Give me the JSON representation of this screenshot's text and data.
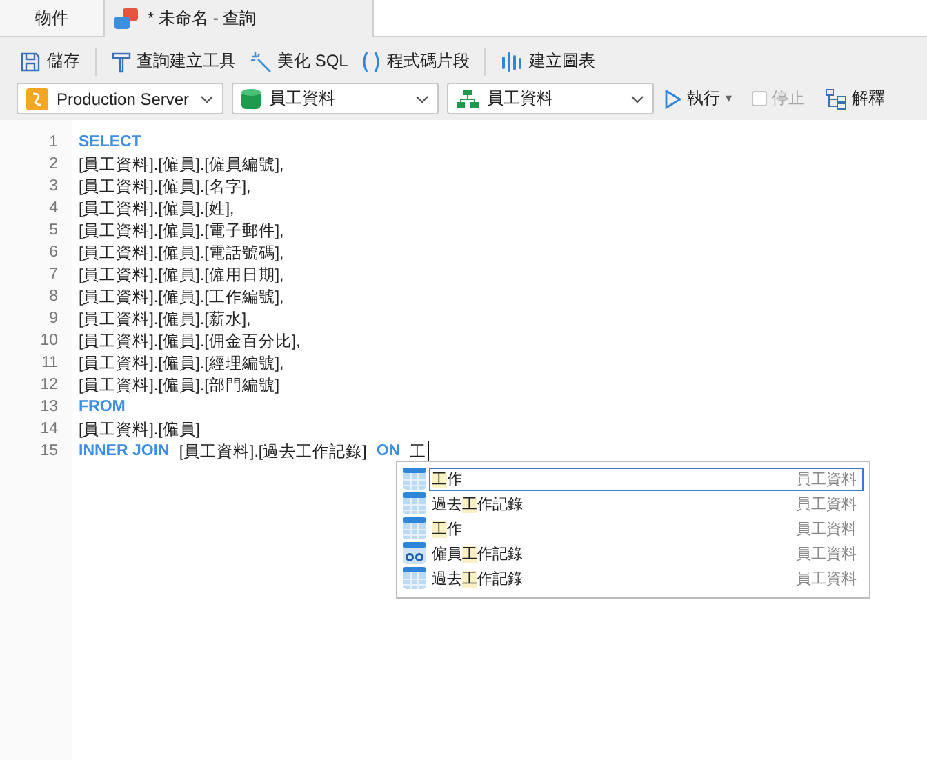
{
  "tabs": [
    {
      "label": "物件",
      "kind": "plain",
      "selected": false
    },
    {
      "label": "* 未命名 - 查詢",
      "kind": "query",
      "selected": true
    }
  ],
  "toolbar": [
    {
      "label": "儲存"
    },
    {
      "label": "查詢建立工具"
    },
    {
      "label": "美化 SQL"
    },
    {
      "label": "程式碼片段"
    },
    {
      "label": "建立圖表"
    }
  ],
  "selectors": [
    {
      "value": "Production Server"
    },
    {
      "value": "員工資料"
    },
    {
      "value": "員工資料"
    }
  ],
  "run": {
    "label": "執行",
    "caret": "▾"
  },
  "stop": {
    "label": "停止",
    "checked": false,
    "disabled": true
  },
  "explain": {
    "label": "解釋"
  },
  "code_lines": [
    {
      "number": "1",
      "tokens": [
        {
          "kind": "keyword",
          "text": "SELECT"
        }
      ]
    },
    {
      "number": "2",
      "tokens": [
        {
          "kind": "text",
          "text": "[員工資料].[僱員].[僱員編號],"
        }
      ]
    },
    {
      "number": "3",
      "tokens": [
        {
          "kind": "text",
          "text": "[員工資料].[僱員].[名字],"
        }
      ]
    },
    {
      "number": "4",
      "tokens": [
        {
          "kind": "text",
          "text": "[員工資料].[僱員].[姓],"
        }
      ]
    },
    {
      "number": "5",
      "tokens": [
        {
          "kind": "text",
          "text": "[員工資料].[僱員].[電子郵件],"
        }
      ]
    },
    {
      "number": "6",
      "tokens": [
        {
          "kind": "text",
          "text": "[員工資料].[僱員].[電話號碼],"
        }
      ]
    },
    {
      "number": "7",
      "tokens": [
        {
          "kind": "text",
          "text": "[員工資料].[僱員].[僱用日期],"
        }
      ]
    },
    {
      "number": "8",
      "tokens": [
        {
          "kind": "text",
          "text": "[員工資料].[僱員].[工作編號],"
        }
      ]
    },
    {
      "number": "9",
      "tokens": [
        {
          "kind": "text",
          "text": "[員工資料].[僱員].[薪水],"
        }
      ]
    },
    {
      "number": "10",
      "tokens": [
        {
          "kind": "text",
          "text": "[員工資料].[僱員].[佣金百分比],"
        }
      ]
    },
    {
      "number": "11",
      "tokens": [
        {
          "kind": "text",
          "text": "[員工資料].[僱員].[經理編號],"
        }
      ]
    },
    {
      "number": "12",
      "tokens": [
        {
          "kind": "text",
          "text": "[員工資料].[僱員].[部門編號]"
        }
      ]
    },
    {
      "number": "13",
      "tokens": [
        {
          "kind": "keyword",
          "text": "FROM"
        }
      ]
    },
    {
      "number": "14",
      "tokens": [
        {
          "kind": "text",
          "text": "[員工資料].[僱員]"
        }
      ]
    },
    {
      "number": "15",
      "cursor": true,
      "tokens": [
        {
          "kind": "keyword",
          "text": "INNER JOIN"
        },
        {
          "kind": "text",
          "text": "[員工資料].[過去工作記錄]"
        },
        {
          "kind": "keyword",
          "text": "ON"
        },
        {
          "kind": "text",
          "text": "工"
        }
      ]
    }
  ],
  "autocomplete": [
    {
      "match": "工",
      "after": "作",
      "schema": "員工資料",
      "kind": "table",
      "selected": true
    },
    {
      "before": "過去",
      "match": "工",
      "after": "作記錄",
      "schema": "員工資料",
      "kind": "table",
      "selected": false
    },
    {
      "match": "工",
      "after": "作",
      "schema": "員工資料",
      "kind": "table",
      "selected": false
    },
    {
      "before": "僱員",
      "match": "工",
      "after": "作記錄",
      "schema": "員工資料",
      "kind": "view",
      "selected": false
    },
    {
      "before": "過去",
      "match": "工",
      "after": "作記錄",
      "schema": "員工資料",
      "kind": "table",
      "selected": false
    }
  ]
}
